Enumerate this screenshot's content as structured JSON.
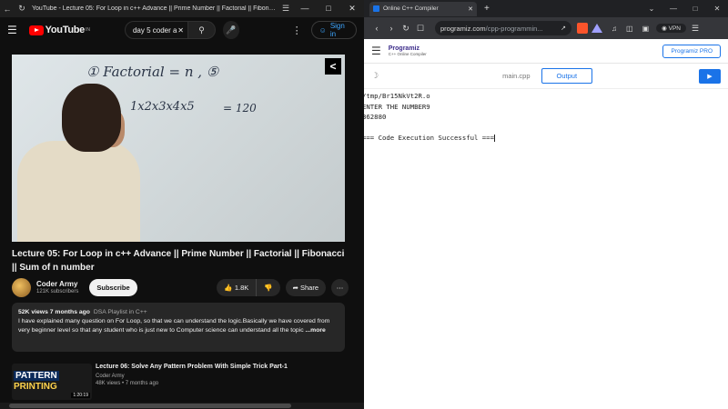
{
  "left_window": {
    "title": "YouTube - Lecture 05: For Loop in c++ Advance || Prime Number || Factorial || Fibonacci || Su...",
    "search_query": "day 5 coder a",
    "sign_in": "Sign in",
    "logo_text": "YouTube",
    "logo_sup": "IN",
    "video": {
      "board_line1": "① Factorial = n , ⑤",
      "board_line2": "1x2x3x4x5",
      "board_line3": "= 120"
    },
    "video_title": "Lecture 05: For Loop in c++ Advance || Prime Number || Factorial || Fibonacci || Sum of n number",
    "channel": {
      "name": "Coder Army",
      "subscribers": "121K subscribers",
      "subscribe_label": "Subscribe",
      "likes": "1.8K",
      "share_label": "Share"
    },
    "description": {
      "views": "52K views",
      "age": "7 months ago",
      "playlist": "DSA Playlist in C++",
      "text": "I have explained many question on For Loop, so that we can understand the logic.Basically we have covered from very beginner level so that any student who is just new to Computer science can understand all the topic",
      "more": "...more"
    },
    "next_video": {
      "thumb_line1": "PATTERN",
      "thumb_line2": "PRINTING",
      "duration": "1:20:19",
      "title": "Lecture 06: Solve Any Pattern Problem With Simple Trick Part-1",
      "channel": "Coder Army",
      "meta": "48K views • 7 months ago"
    }
  },
  "right_window": {
    "tab_title": "Online C++ Compiler",
    "url_domain": "programiz.com",
    "url_path": "/cpp-programmin...",
    "vpn": "VPN",
    "brand_name": "Programiz",
    "brand_sub": "C++ Online Compiler",
    "pro_button": "Programiz PRO",
    "file_tab": "main.cpp",
    "output_tab": "Output",
    "output_lines": [
      "/tmp/Br15NkVt2R.o",
      "ENTER THE NUMBER9",
      "362880",
      "",
      "=== Code Execution Successful ==="
    ]
  }
}
